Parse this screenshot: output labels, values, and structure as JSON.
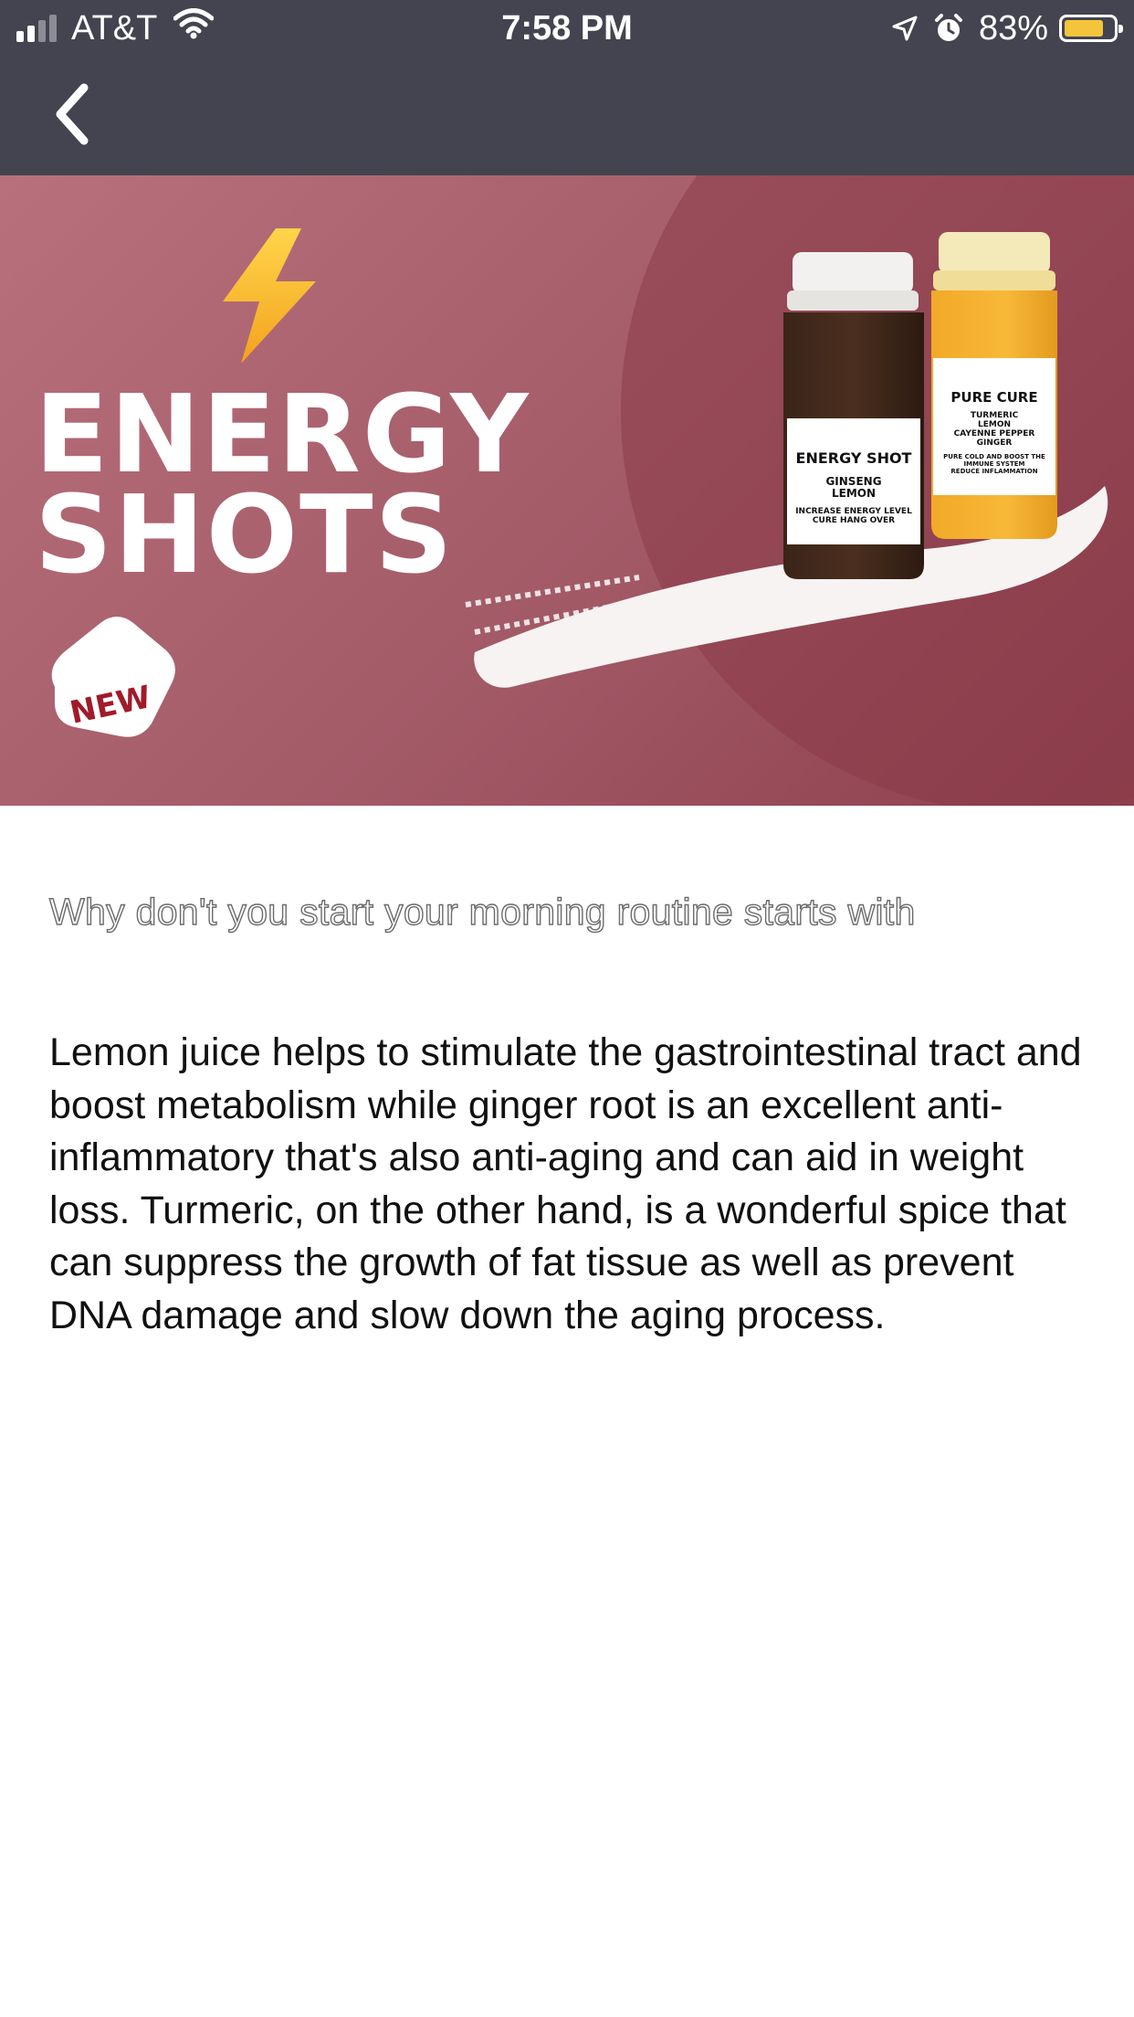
{
  "status_bar": {
    "carrier": "AT&T",
    "time": "7:58 PM",
    "battery": "83%",
    "battery_level": 0.83,
    "battery_color": "#f4c53a",
    "icons": [
      "signal-icon",
      "wifi-icon",
      "location-arrow-icon",
      "alarm-icon",
      "battery-icon"
    ]
  },
  "nav": {
    "back_icon": "chevron-left-icon",
    "background": "#434450"
  },
  "hero": {
    "title": "ENERGY\nSHOTS",
    "badge": "NEW",
    "icon": "lightning-bolt-icon",
    "bottle_1": {
      "label": "ENERGY SHOT",
      "ingredients": "GINSENG\nLEMON",
      "note": "INCREASE ENERGY LEVEL\nCURE HANG OVER"
    },
    "bottle_2": {
      "label": "PURE CURE",
      "ingredients": "TURMERIC\nLEMON\nCAYENNE PEPPER\nGINGER",
      "note": "PURE COLD AND BOOST THE\nIMMUNE SYSTEM\nREDUCE INFLAMMATION"
    }
  },
  "content": {
    "intro": "Why don't you start your morning routine starts with",
    "body": "Lemon juice helps to stimulate the gastrointestinal tract and boost metabolism while ginger root is an excellent anti-inflammatory that's also anti-aging and can aid in weight loss. Turmeric, on the other hand, is a wonderful spice that can suppress the growth of fat tissue as well as prevent DNA damage and slow down the aging process."
  }
}
